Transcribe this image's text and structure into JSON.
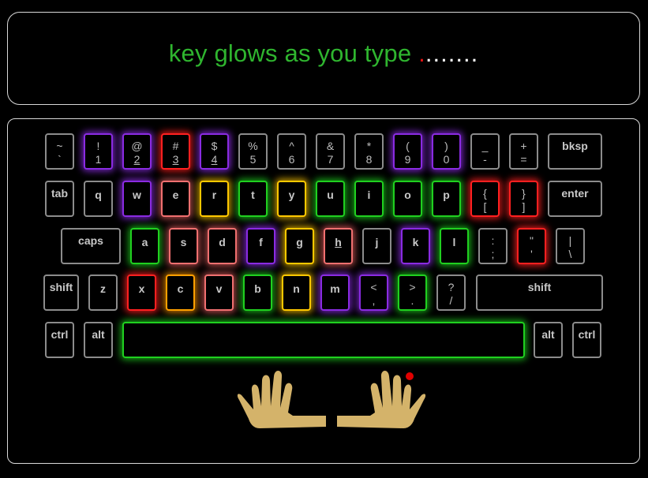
{
  "prompt": {
    "typed": "key glows as you type ",
    "cursor_char": ".",
    "remaining": "......."
  },
  "colors": {
    "purple": "#8a2be2",
    "red": "#ff2020",
    "pink": "#f07070",
    "orange": "#ffa000",
    "yellow": "#ffc800",
    "green": "#20d020",
    "hands": "#d4b36a",
    "finger_marker": "#e00000"
  },
  "keys": {
    "tilde": {
      "top": "~",
      "bot": "`"
    },
    "k1": {
      "top": "!",
      "bot": "1"
    },
    "k2": {
      "top": "@",
      "bot": "2"
    },
    "k3": {
      "top": "#",
      "bot": "3"
    },
    "k4": {
      "top": "$",
      "bot": "4"
    },
    "k5": {
      "top": "%",
      "bot": "5"
    },
    "k6": {
      "top": "^",
      "bot": "6"
    },
    "k7": {
      "top": "&",
      "bot": "7"
    },
    "k8": {
      "top": "*",
      "bot": "8"
    },
    "k9": {
      "top": "(",
      "bot": "9"
    },
    "k0": {
      "top": ")",
      "bot": "0"
    },
    "minus": {
      "top": "_",
      "bot": "-"
    },
    "equal": {
      "top": "+",
      "bot": "="
    },
    "bksp": "bksp",
    "tab": "tab",
    "q": "q",
    "w": "w",
    "e": "e",
    "r": "r",
    "t": "t",
    "y": "y",
    "u": "u",
    "i": "i",
    "o": "o",
    "p": "p",
    "lbracket": {
      "top": "{",
      "bot": "["
    },
    "rbracket": {
      "top": "}",
      "bot": "]"
    },
    "enter": "enter",
    "caps": "caps",
    "a": "a",
    "s": "s",
    "d": "d",
    "f": "f",
    "g": "g",
    "h": "h",
    "j": "j",
    "k": "k",
    "l": "l",
    "semicolon": {
      "top": ":",
      "bot": ";"
    },
    "quote": {
      "top": "\"",
      "bot": "'"
    },
    "backslash": {
      "top": "|",
      "bot": "\\"
    },
    "lshift": "shift",
    "z": "z",
    "x": "x",
    "c": "c",
    "v": "v",
    "b": "b",
    "n": "n",
    "m": "m",
    "comma": {
      "top": "<",
      "bot": ","
    },
    "period": {
      "top": ">",
      "bot": "."
    },
    "slash": {
      "top": "?",
      "bot": "/"
    },
    "rshift": "shift",
    "lctrl": "ctrl",
    "lalt": "alt",
    "ralt": "alt",
    "rctrl": "ctrl"
  }
}
